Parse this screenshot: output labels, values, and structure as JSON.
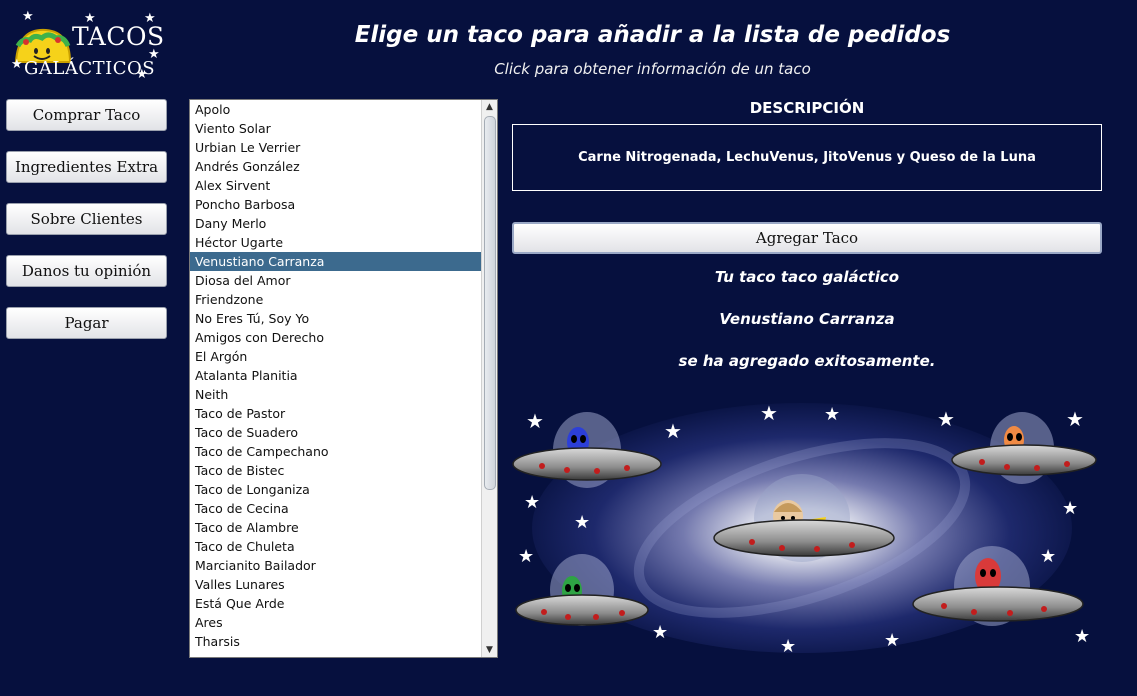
{
  "logo": {
    "title": "TACOS",
    "subtitle": "GALÁCTICOS"
  },
  "header": {
    "title": "Elige un taco para añadir a la lista de pedidos",
    "subtitle": "Click para obtener información de un taco"
  },
  "nav": {
    "items": [
      {
        "label": "Comprar Taco"
      },
      {
        "label": "Ingredientes Extra"
      },
      {
        "label": "Sobre Clientes"
      },
      {
        "label": "Danos tu opinión"
      },
      {
        "label": "Pagar"
      }
    ]
  },
  "taco_list": {
    "selected": "Venustiano Carranza",
    "items": [
      "Apolo",
      "Viento Solar",
      "Urbian Le Verrier",
      "Andrés González",
      "Alex Sirvent",
      "Poncho Barbosa",
      "Dany Merlo",
      "Héctor Ugarte",
      "Venustiano Carranza",
      "Diosa del Amor",
      "Friendzone",
      "No Eres Tú, Soy Yo",
      "Amigos con Derecho",
      "El Argón",
      "Atalanta Planitia",
      "Neith",
      "Taco de Pastor",
      "Taco de Suadero",
      "Taco de Campechano",
      "Taco de Bistec",
      "Taco de Longaniza",
      "Taco de Cecina",
      "Taco de Alambre",
      "Taco de Chuleta",
      "Marcianito Bailador",
      "Valles Lunares",
      "Está Que Arde",
      "Ares",
      "Tharsis"
    ]
  },
  "description": {
    "heading": "DESCRIPCIÓN",
    "text": "Carne Nitrogenada, LechuVenus, JitoVenus y Queso de la Luna"
  },
  "add_button": {
    "label": "Agregar Taco"
  },
  "confirmation": {
    "line1": "Tu taco taco galáctico",
    "taco_name": "Venustiano Carranza",
    "line3": "se ha agregado exitosamente."
  },
  "colors": {
    "background": "#06103e",
    "selection": "#3c6a8e"
  }
}
